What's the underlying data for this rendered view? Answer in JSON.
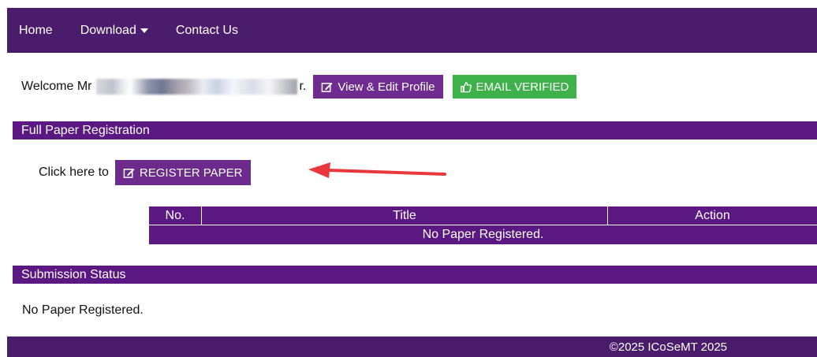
{
  "nav": {
    "items": [
      {
        "label": "Home"
      },
      {
        "label": "Download"
      },
      {
        "label": "Contact Us"
      }
    ]
  },
  "welcome": {
    "prefix": "Welcome Mr",
    "suffix": "r.",
    "edit_profile_label": "View & Edit Profile",
    "email_verified_label": "EMAIL VERIFIED"
  },
  "full_paper": {
    "heading": "Full Paper Registration",
    "click_text": "Click here to",
    "register_label": "REGISTER PAPER"
  },
  "papers_table": {
    "columns": [
      "No.",
      "Title",
      "Action"
    ],
    "empty_message": "No Paper Registered."
  },
  "submission_status": {
    "heading": "Submission Status",
    "message": "No Paper Registered."
  },
  "footer": {
    "copyright": "©2025 ICoSeMT 2025"
  },
  "colors": {
    "nav_bg": "#4b1c6b",
    "section_bg": "#5b1883",
    "button_purple": "#6f2b8f",
    "button_green": "#3fb14a",
    "arrow_red": "#e8383b"
  },
  "icons": {
    "edit": "edit-icon",
    "thumbs_up": "thumbs-up-icon",
    "dropdown": "caret-down-icon"
  }
}
